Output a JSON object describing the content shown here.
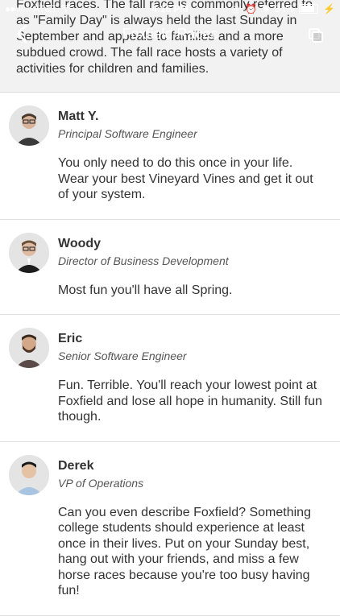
{
  "status_bar": {
    "carrier": "AT&T",
    "time": "4:16 PM",
    "battery_percent": "84%",
    "battery_level": 0.84
  },
  "nav": {
    "title": "Foxfield Races"
  },
  "intro": {
    "text": "Foxfield races. The fall race is commonly referred to as \"Family Day\" is always held the last Sunday in September and appeals to families and a more subdued crowd.  The fall race hosts a variety of activities for children and families."
  },
  "reviews": [
    {
      "name": "Matt Y.",
      "role": "Principal Software Engineer",
      "text": "You only need to do this once in your life. Wear your best Vineyard Vines and get it out of your system."
    },
    {
      "name": "Woody",
      "role": "Director of Business Development",
      "text": "Most fun you'll have all Spring."
    },
    {
      "name": "Eric",
      "role": "Senior Software Engineer",
      "text": "Fun. Terrible. You'll reach your lowest point at Foxfield and lose all hope in humanity. Still fun though."
    },
    {
      "name": "Derek",
      "role": "VP of Operations",
      "text": "Can you even describe Foxfield?  Something college students should experience at least once in their lives.  Put on your Sunday best, hang out with your friends, and miss a few horse races because you're too busy having fun!"
    }
  ],
  "colors": {
    "background": "#ffffff",
    "intro_bg": "#f2f2f2",
    "text": "#333333",
    "divider": "#e0e0e0"
  }
}
